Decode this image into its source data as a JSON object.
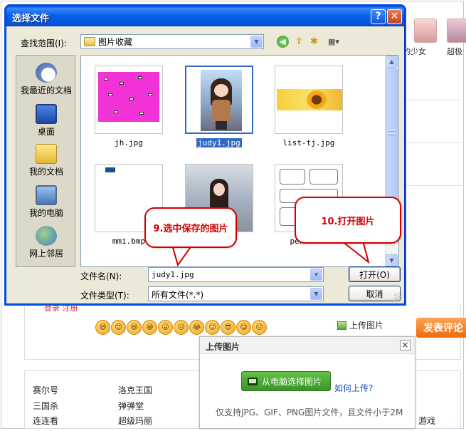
{
  "background_page": {
    "thumbs": [
      {
        "label": "的少女"
      },
      {
        "label": "超极"
      }
    ],
    "tabs_text": "登录 注册",
    "emoji_glyphs": [
      "😄",
      "😍",
      "😆",
      "😁",
      "😜",
      "😒",
      "😂",
      "😊",
      "😎",
      "😋",
      "😔"
    ],
    "upload_link": "上传图片",
    "post_button": "发表评论",
    "games_col1": [
      "赛尔号",
      "三国杀",
      "连连看"
    ],
    "games_col2": [
      "洛克王国",
      "弹弹堂",
      "超级玛丽"
    ],
    "games_extra": "游戏",
    "upload_panel": {
      "title": "上传图片",
      "close": "×",
      "pick_button": "从电脑选择图片",
      "help_link": "如何上传?",
      "note": "仅支持JPG、GIF、PNG图片文件，且文件小于2M"
    }
  },
  "dialog": {
    "title": "选择文件",
    "help_button": "?",
    "close_button": "✕",
    "look_in_label": "查找范围(I):",
    "look_in_value": "图片收藏",
    "places": [
      {
        "label": "我最近的文档"
      },
      {
        "label": "桌面"
      },
      {
        "label": "我的文档"
      },
      {
        "label": "我的电脑"
      },
      {
        "label": "网上邻居"
      }
    ],
    "files": [
      {
        "name": "jh.jpg"
      },
      {
        "name": "judy1.jpg"
      },
      {
        "name": "list-tj.jpg"
      },
      {
        "name": "mmi.bmp"
      },
      {
        "name": ""
      },
      {
        "name": "pencilma"
      }
    ],
    "filename_label": "文件名(N):",
    "filename_value": "judy1.jpg",
    "filetype_label": "文件类型(T):",
    "filetype_value": "所有文件(*.*)",
    "open_button": "打开(O)",
    "cancel_button": "取消"
  },
  "callouts": {
    "step9": "9.选中保存的图片",
    "step10": "10.打开图片"
  }
}
